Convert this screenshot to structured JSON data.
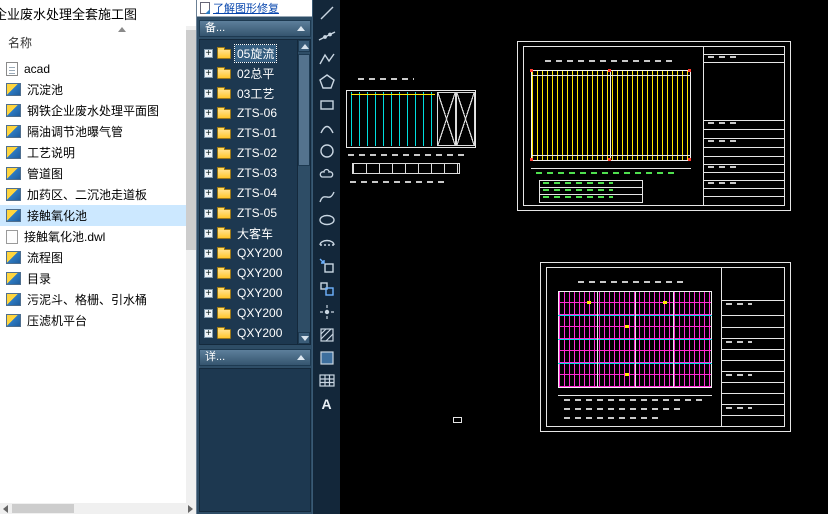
{
  "explorer": {
    "title": "企业废水处理全套施工图",
    "column_header": "名称",
    "items": [
      {
        "label": "acad",
        "icon": "acad-file-icon",
        "selected": false
      },
      {
        "label": "沉淀池",
        "icon": "dwg-file-icon",
        "selected": false
      },
      {
        "label": "钢铁企业废水处理平面图",
        "icon": "dwg-file-icon",
        "selected": false
      },
      {
        "label": "隔油调节池曝气管",
        "icon": "dwg-file-icon",
        "selected": false
      },
      {
        "label": "工艺说明",
        "icon": "dwg-file-icon",
        "selected": false
      },
      {
        "label": "管道图",
        "icon": "dwg-file-icon",
        "selected": false
      },
      {
        "label": "加药区、二沉池走道板",
        "icon": "dwg-file-icon",
        "selected": false
      },
      {
        "label": "接触氧化池",
        "icon": "dwg-file-icon",
        "selected": true
      },
      {
        "label": "接触氧化池.dwl",
        "icon": "plain-file-icon",
        "selected": false
      },
      {
        "label": "流程图",
        "icon": "dwg-file-icon",
        "selected": false
      },
      {
        "label": "目录",
        "icon": "dwg-file-icon",
        "selected": false
      },
      {
        "label": "污泥斗、格栅、引水桶",
        "icon": "dwg-file-icon",
        "selected": false
      },
      {
        "label": "压滤机平台",
        "icon": "dwg-file-icon",
        "selected": false
      }
    ]
  },
  "palette": {
    "repair_link": "了解图形修复",
    "backup_header": "备...",
    "details_header": "详...",
    "tree_items": [
      {
        "label": "05旋流",
        "selected": true
      },
      {
        "label": "02总平",
        "selected": false
      },
      {
        "label": "03工艺",
        "selected": false
      },
      {
        "label": "ZTS-06",
        "selected": false
      },
      {
        "label": "ZTS-01",
        "selected": false
      },
      {
        "label": "ZTS-02",
        "selected": false
      },
      {
        "label": "ZTS-03",
        "selected": false
      },
      {
        "label": "ZTS-04",
        "selected": false
      },
      {
        "label": "ZTS-05",
        "selected": false
      },
      {
        "label": "大客车",
        "selected": false
      },
      {
        "label": "QXY200",
        "selected": false
      },
      {
        "label": "QXY200",
        "selected": false
      },
      {
        "label": "QXY200",
        "selected": false
      },
      {
        "label": "QXY200",
        "selected": false
      },
      {
        "label": "QXY200",
        "selected": false
      }
    ]
  },
  "toolbar": {
    "tools": [
      "line",
      "construction-line",
      "polyline",
      "polygon",
      "rectangle",
      "arc",
      "circle",
      "revision-cloud",
      "spline",
      "ellipse",
      "ellipse-arc",
      "insert-block",
      "make-block",
      "point",
      "hatch",
      "gradient",
      "table",
      "mtext"
    ],
    "text_tool_glyph": "A"
  },
  "canvas": {
    "colors": {
      "line": "#e6e6e6",
      "yellow": "#ffe900",
      "cyan": "#00dede",
      "magenta": "#ff2ad4",
      "red": "#ff3b30",
      "green": "#4fe04f",
      "background": "#000000"
    }
  }
}
